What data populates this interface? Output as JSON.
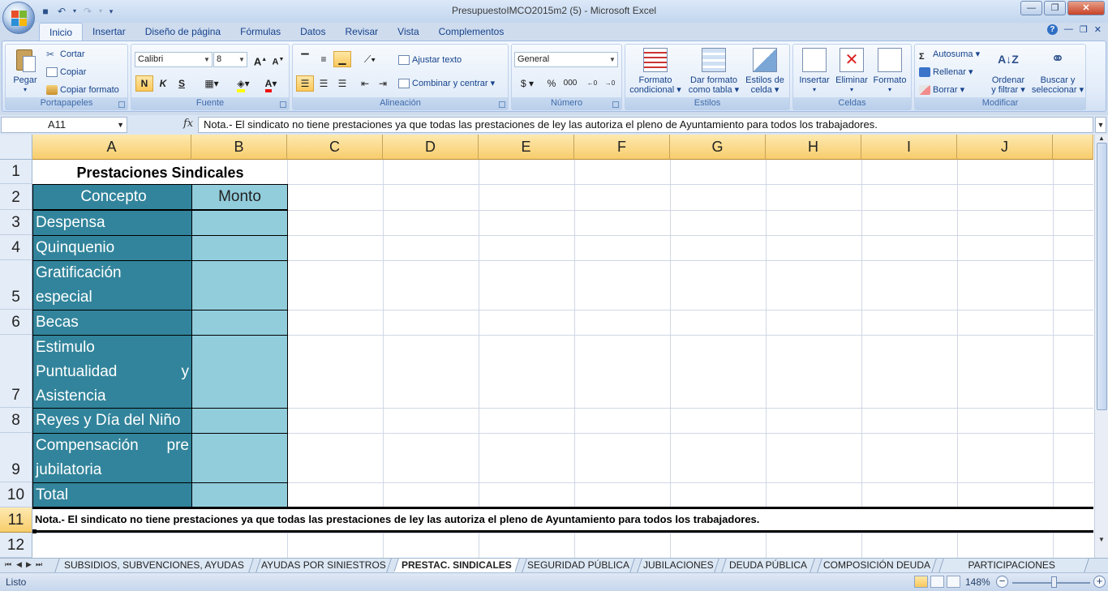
{
  "window": {
    "title": "PresupuestoIMCO2015m2 (5) - Microsoft Excel"
  },
  "qat": {
    "save": "save-icon",
    "undo": "undo-icon",
    "redo": "redo-icon"
  },
  "tabs": [
    "Inicio",
    "Insertar",
    "Diseño de página",
    "Fórmulas",
    "Datos",
    "Revisar",
    "Vista",
    "Complementos"
  ],
  "active_tab": "Inicio",
  "ribbon": {
    "clipboard": {
      "label": "Portapapeles",
      "paste": "Pegar",
      "cut": "Cortar",
      "copy": "Copiar",
      "format_painter": "Copiar formato"
    },
    "font": {
      "label": "Fuente",
      "name": "Calibri",
      "size": "8",
      "bold": "N",
      "italic": "K",
      "underline": "S"
    },
    "alignment": {
      "label": "Alineación",
      "wrap": "Ajustar texto",
      "merge": "Combinar y centrar"
    },
    "number": {
      "label": "Número",
      "format": "General",
      "currency": "$",
      "percent": "%",
      "thousands": "000"
    },
    "styles": {
      "label": "Estilos",
      "conditional_1": "Formato",
      "conditional_2": "condicional",
      "table_1": "Dar formato",
      "table_2": "como tabla",
      "cell_1": "Estilos de",
      "cell_2": "celda"
    },
    "cells": {
      "label": "Celdas",
      "insert": "Insertar",
      "delete": "Eliminar",
      "format": "Formato"
    },
    "editing": {
      "label": "Modificar",
      "autosum": "Autosuma",
      "fill": "Rellenar",
      "clear": "Borrar",
      "sort_1": "Ordenar",
      "sort_2": "y filtrar",
      "find_1": "Buscar y",
      "find_2": "seleccionar"
    }
  },
  "formula_bar": {
    "name_box": "A11",
    "fx": "fx",
    "formula": "Nota.- El sindicato no tiene prestaciones ya que todas las prestaciones de ley las autoriza el pleno de Ayuntamiento para todos los trabajadores."
  },
  "columns": [
    "A",
    "B",
    "C",
    "D",
    "E",
    "F",
    "G",
    "H",
    "I",
    "J"
  ],
  "rows": [
    "1",
    "2",
    "3",
    "4",
    "5",
    "6",
    "7",
    "8",
    "9",
    "10",
    "11",
    "12"
  ],
  "cells": {
    "title": "Prestaciones Sindicales",
    "header_concept": "Concepto",
    "header_amount": "Monto",
    "items": [
      {
        "lines": [
          "Despensa"
        ]
      },
      {
        "lines": [
          "Quinquenio"
        ]
      },
      {
        "lines": [
          "Gratificación",
          "especial"
        ]
      },
      {
        "lines": [
          "Becas"
        ]
      },
      {
        "lines": [
          "Estimulo",
          "Puntualidad y",
          "Asistencia"
        ]
      },
      {
        "lines": [
          "Reyes y Día del Niño"
        ]
      },
      {
        "lines": [
          "Compensación pre",
          "jubilatoria"
        ]
      },
      {
        "lines": [
          "Total"
        ]
      }
    ],
    "note": "Nota.- El sindicato no tiene prestaciones ya que todas las prestaciones de ley las autoriza el pleno de Ayuntamiento para todos los trabajadores."
  },
  "sheet_tabs": [
    "SUBSIDIOS, SUBVENCIONES, AYUDAS",
    "AYUDAS POR SINIESTROS",
    "PRESTAC. SINDICALES",
    "SEGURIDAD PÚBLICA",
    "JUBILACIONES",
    "DEUDA PÚBLICA",
    "COMPOSICIÓN DEUDA",
    "PARTICIPACIONES FEDERALES"
  ],
  "active_sheet": "PRESTAC. SINDICALES",
  "status": {
    "ready": "Listo",
    "zoom": "148%"
  },
  "colors": {
    "concept_fill": "#31849b",
    "amount_fill": "#92cddc",
    "header_fill": "#f8cd6c"
  }
}
